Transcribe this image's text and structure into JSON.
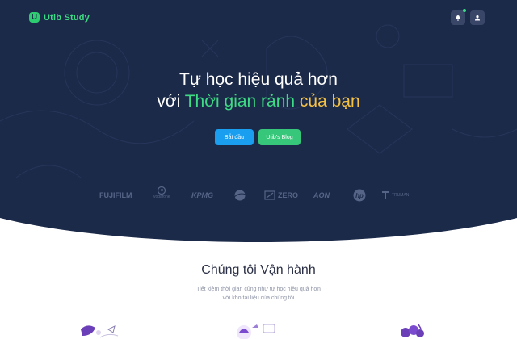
{
  "header": {
    "logo_mark": "U",
    "logo_text": "Utib Study",
    "icons": [
      "bell-icon",
      "user-icon"
    ]
  },
  "hero": {
    "headline_line1": "Tự học hiệu quả hơn",
    "headline_prefix": "với ",
    "headline_green": "Thời gian rảnh",
    "headline_yellow": " của bạn",
    "start_button": "Bắt đầu",
    "blog_button": "Utib's Blog"
  },
  "partners": {
    "fujifilm": "FUJIFILM",
    "vodafone": "vodafone",
    "kpmg": "KPMG",
    "nasa": "NASA",
    "zero": "ZERO",
    "aon": "AON",
    "hp": "hp",
    "truman": "TRUMAN"
  },
  "section": {
    "title": "Chúng tôi Vận hành",
    "subtitle_line1": "Tiết kiệm thời gian cũng như tự học hiệu quả hơn",
    "subtitle_line2": "với kho tài liệu của chúng tôi"
  },
  "colors": {
    "hero_bg": "#1c2a49",
    "brand_green": "#3ddc84",
    "accent_yellow": "#f6c244",
    "button_blue": "#1a9ef0",
    "button_green": "#37c77a"
  }
}
